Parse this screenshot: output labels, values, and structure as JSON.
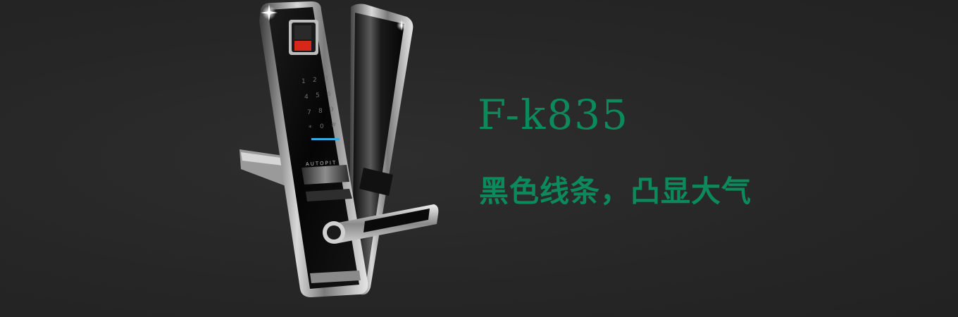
{
  "product": {
    "model": "F-k835",
    "slogan": "黑色线条，凸显大气",
    "brand_label": "AUTOPIT",
    "keypad_keys": [
      "1",
      "2",
      "3",
      "4",
      "5",
      "6",
      "7",
      "8",
      "9",
      "*",
      "0",
      "#"
    ]
  },
  "colors": {
    "background": "#272727",
    "accent_green": "#0d8a5c",
    "fingerprint_red": "#d8261a",
    "indicator_blue": "#3aa6e0"
  },
  "icons": {
    "product_image": "smart-door-lock-image",
    "fingerprint_sensor": "fingerprint-sensor-icon"
  }
}
